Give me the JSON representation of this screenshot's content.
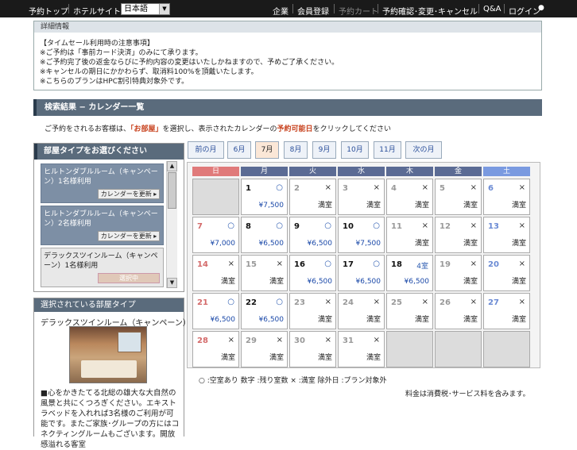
{
  "topbar": {
    "reserve_top": "予約トップ",
    "hotel_site": "ホテルサイト",
    "language": "日本語",
    "links": [
      "企業",
      "会員登録",
      "予約カート",
      "予約確認･変更･キャンセル",
      "Q&A",
      "ログイン"
    ]
  },
  "detail": {
    "header": "詳細情報",
    "lines": [
      "【タイムセール利用時の注意事項】",
      "※ご予約は「事前カード決済」のみにて承ります。",
      "※ご予約完了後の返金ならびに予約内容の変更はいたしかねますので、予めご了承ください。",
      "※キャンセルの期日にかかわらず、取消料100%を頂戴いたします。",
      "※こちらのプランはHPC割引特典対象外です。"
    ]
  },
  "section_title": "検索結果 − カレンダー一覧",
  "intro": {
    "before": "ご予約をされるお客様は、",
    "room": "「お部屋」",
    "middle": "を選択し、表示されたカレンダーの",
    "date": "予約可能日",
    "after": "をクリックしてください"
  },
  "room_panel": {
    "header": "部屋タイプをお選びください",
    "rooms": [
      {
        "name": "ヒルトンダブルルーム（キャンペーン）1名様利用",
        "button": "カレンダーを更新"
      },
      {
        "name": "ヒルトンダブルルーム（キャンペーン）2名様利用",
        "button": "カレンダーを更新"
      },
      {
        "name": "デラックスツインルーム（キャンペーン）1名様利用",
        "button": "選択中"
      }
    ]
  },
  "selected_panel": {
    "header": "選択されている部屋タイプ",
    "room_name": "デラックスツインルーム（キャンペーン）",
    "description": "■心をかきたてる北総の雄大な大自然の風景と共にくつろぎください。エキストラベッドを入れれば3名様のご利用が可能です。またご家族･グループの方にはコネクティングルームもございます。開放感溢れる客室",
    "more": "れる客室"
  },
  "months": [
    "前の月",
    "6月",
    "7月",
    "8月",
    "9月",
    "10月",
    "11月",
    "次の月"
  ],
  "current_month": "7月",
  "weekdays": [
    "日",
    "月",
    "火",
    "水",
    "木",
    "金",
    "土"
  ],
  "weekday_colors": [
    "#e07a7a",
    "#5b6b94",
    "#5b6b94",
    "#5b6b94",
    "#5b6b94",
    "#5b6b94",
    "#7a9ae0"
  ],
  "calendar": [
    [
      null,
      {
        "day": "1",
        "mark": "○",
        "price": "¥7,500"
      },
      {
        "day": "2",
        "mark": "×",
        "full": "満室"
      },
      {
        "day": "3",
        "mark": "×",
        "full": "満室"
      },
      {
        "day": "4",
        "mark": "×",
        "full": "満室"
      },
      {
        "day": "5",
        "mark": "×",
        "full": "満室"
      },
      {
        "day": "6",
        "mark": "×",
        "full": "満室"
      }
    ],
    [
      {
        "day": "7",
        "mark": "○",
        "price": "¥7,000"
      },
      {
        "day": "8",
        "mark": "○",
        "price": "¥6,500"
      },
      {
        "day": "9",
        "mark": "○",
        "price": "¥6,500"
      },
      {
        "day": "10",
        "mark": "○",
        "price": "¥7,500"
      },
      {
        "day": "11",
        "mark": "×",
        "full": "満室"
      },
      {
        "day": "12",
        "mark": "×",
        "full": "満室"
      },
      {
        "day": "13",
        "mark": "×",
        "full": "満室"
      }
    ],
    [
      {
        "day": "14",
        "mark": "×",
        "full": "満室"
      },
      {
        "day": "15",
        "mark": "×",
        "full": "満室"
      },
      {
        "day": "16",
        "mark": "○",
        "price": "¥6,500"
      },
      {
        "day": "17",
        "mark": "○",
        "price": "¥6,500"
      },
      {
        "day": "18",
        "mark": "4室",
        "price": "¥6,500"
      },
      {
        "day": "19",
        "mark": "×",
        "full": "満室"
      },
      {
        "day": "20",
        "mark": "×",
        "full": "満室"
      }
    ],
    [
      {
        "day": "21",
        "mark": "○",
        "price": "¥6,500"
      },
      {
        "day": "22",
        "mark": "○",
        "price": "¥6,500"
      },
      {
        "day": "23",
        "mark": "×",
        "full": "満室"
      },
      {
        "day": "24",
        "mark": "×",
        "full": "満室"
      },
      {
        "day": "25",
        "mark": "×",
        "full": "満室"
      },
      {
        "day": "26",
        "mark": "×",
        "full": "満室"
      },
      {
        "day": "27",
        "mark": "×",
        "full": "満室"
      }
    ],
    [
      {
        "day": "28",
        "mark": "×",
        "full": "満室"
      },
      {
        "day": "29",
        "mark": "×",
        "full": "満室"
      },
      {
        "day": "30",
        "mark": "×",
        "full": "満室"
      },
      {
        "day": "31",
        "mark": "×",
        "full": "満室"
      },
      null,
      null,
      null
    ]
  ],
  "legend": "○ :空室あり 数字 :残り室数 × :満室 除外日 :プラン対象外",
  "tax_note": "料金は消費税･サービス料を含みます。",
  "colors": {
    "accent_red": "#c8421e",
    "price_blue": "#1a48a8",
    "header_slate": "#5a6b7c"
  }
}
